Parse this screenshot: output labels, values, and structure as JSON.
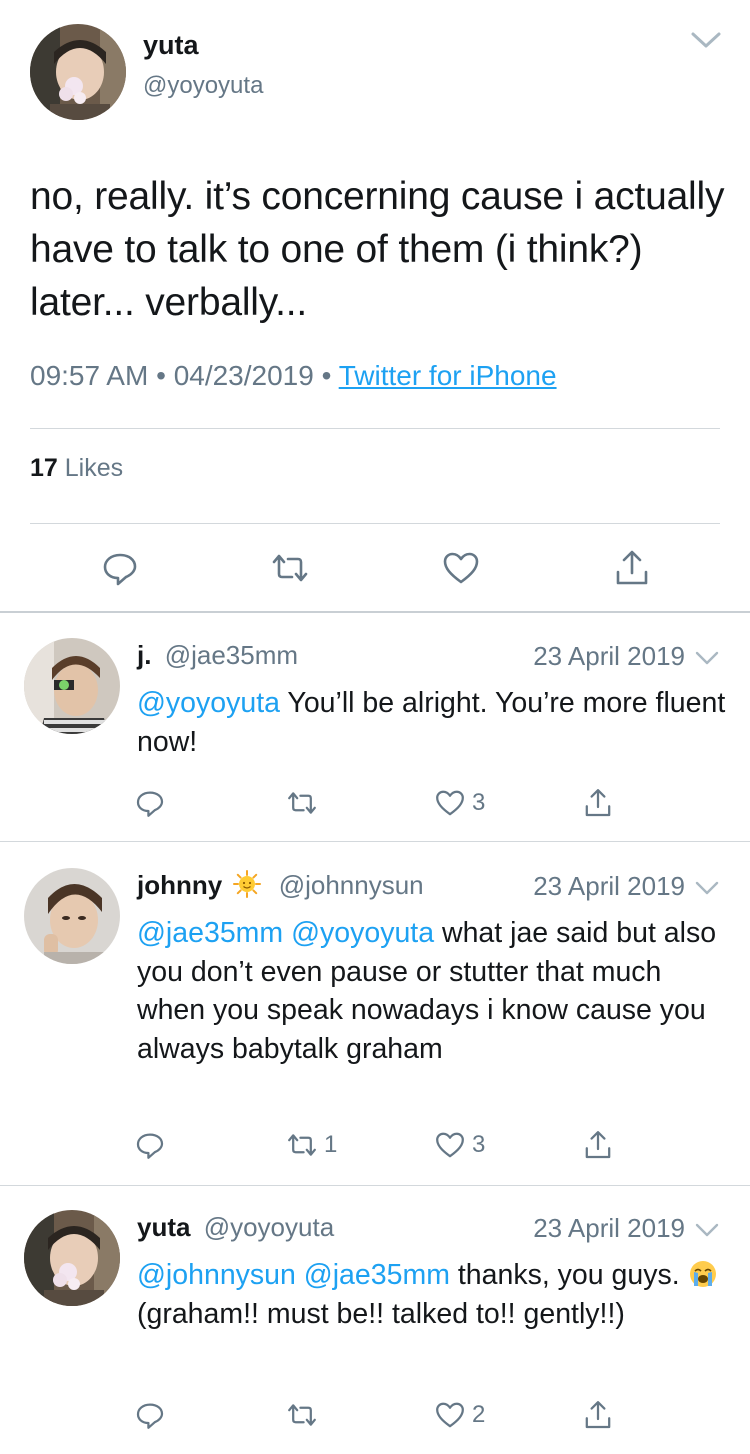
{
  "main_tweet": {
    "name": "yuta",
    "handle": "@yoyoyuta",
    "text": "no, really. it’s concerning cause i actually have to talk to one of them (i think?) later... verbally...",
    "time": "09:57 AM",
    "date": "04/23/2019",
    "source": "Twitter for iPhone",
    "likes_count": "17",
    "likes_label": "Likes"
  },
  "replies": [
    {
      "name": "j.",
      "handle": "@jae35mm",
      "date": "23 April 2019",
      "mentions": "@yoyoyuta",
      "text": "You’ll be alright. You’re more fluent now!",
      "retweets": "",
      "likes": "3"
    },
    {
      "name": "johnny",
      "handle": "@johnnysun",
      "date": "23 April 2019",
      "mentions": "@jae35mm @yoyoyuta",
      "text": "what jae said but also you don’t even pause or stutter that much when you speak nowadays i know cause you always babytalk graham",
      "retweets": "1",
      "likes": "3"
    },
    {
      "name": "yuta",
      "handle": "@yoyoyuta",
      "date": "23 April 2019",
      "mentions": "@johnnysun @jae35mm",
      "text_before_emoji": "thanks, you guys.",
      "text_after_emoji": "(graham!! must be!! talked to!! gently!!)",
      "retweets": "",
      "likes": "2"
    }
  ],
  "icons": {
    "reply": "reply-icon",
    "retweet": "retweet-icon",
    "like": "heart-icon",
    "share": "share-icon",
    "more": "chevron-down-icon"
  },
  "colors": {
    "link": "#1da1f2",
    "secondary": "#657786",
    "text": "#14171a"
  }
}
